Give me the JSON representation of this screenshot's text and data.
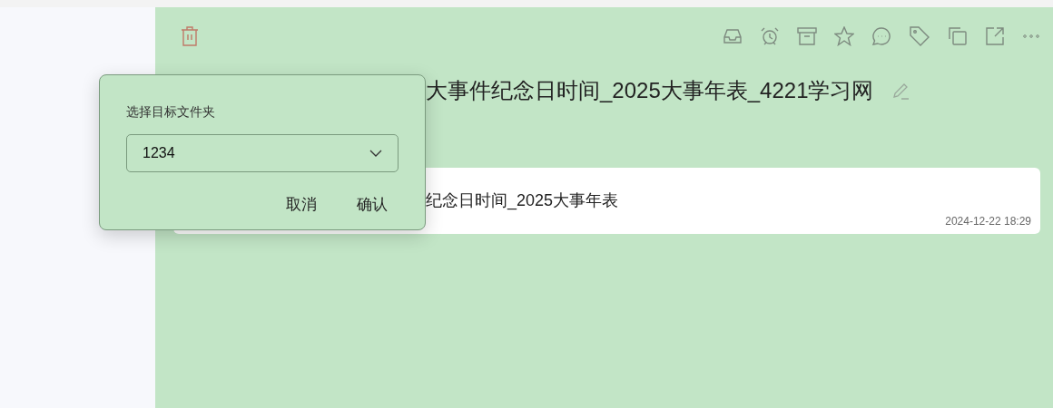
{
  "title": "大事件纪念日时间_2025大事年表_4221学习网",
  "note": {
    "text": "纪念日时间_2025大事年表",
    "time": "2024-12-22 18:29"
  },
  "move_dialog": {
    "label": "选择目标文件夹",
    "folder": "1234",
    "buttons": [
      "取消",
      "确认"
    ]
  }
}
